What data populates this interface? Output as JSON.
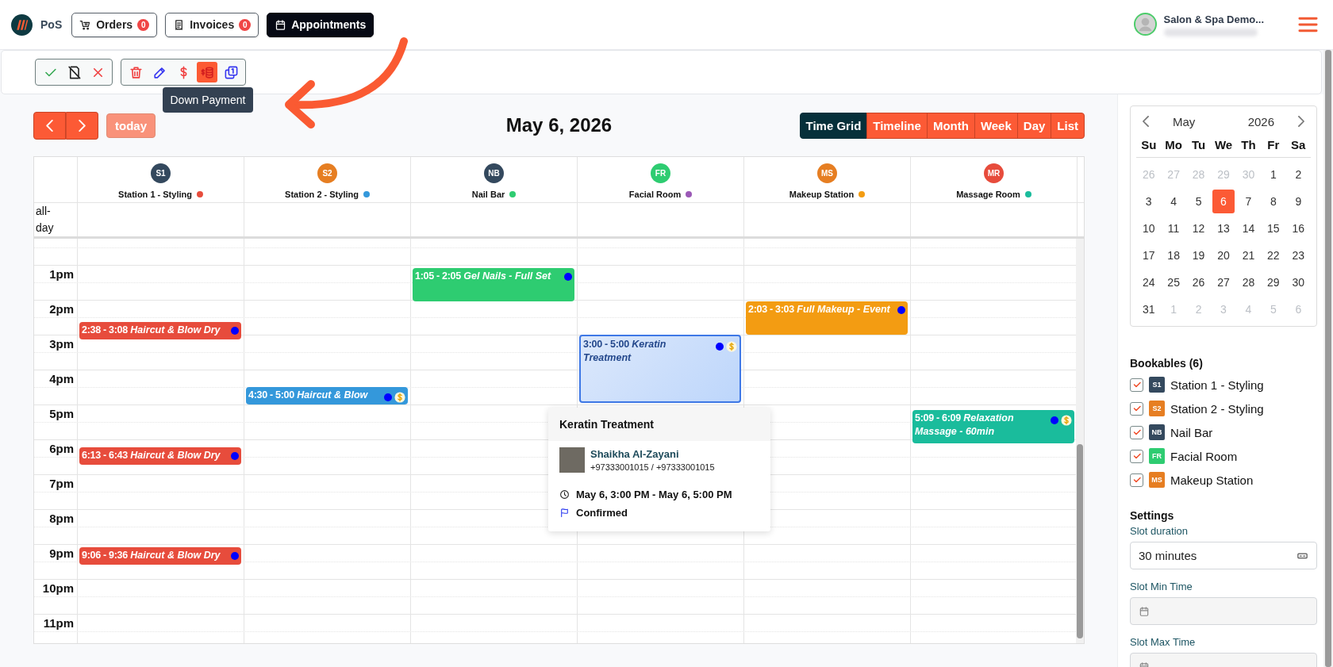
{
  "topbar": {
    "brand": "PoS",
    "tabs": [
      {
        "label": "Orders",
        "kind": "orders",
        "badge": "0",
        "selected": false
      },
      {
        "label": "Invoices",
        "kind": "invoices",
        "badge": "0",
        "selected": false
      },
      {
        "label": "Appointments",
        "kind": "appointments",
        "selected": true
      }
    ],
    "user": {
      "name": "Salon & Spa Demo..."
    }
  },
  "toolbar": {
    "groups": [
      {
        "buttons": [
          {
            "kind": "confirm",
            "selected": false
          },
          {
            "kind": "no_show",
            "selected": false
          },
          {
            "kind": "cancel",
            "selected": false
          }
        ]
      },
      {
        "buttons": [
          {
            "kind": "delete",
            "selected": false
          },
          {
            "kind": "edit",
            "selected": false
          },
          {
            "kind": "payment",
            "selected": false
          },
          {
            "kind": "down_payment",
            "selected": true
          },
          {
            "kind": "duplicate",
            "selected": false
          }
        ]
      }
    ],
    "tooltip": "Down Payment"
  },
  "calendar": {
    "title": "May 6, 2026",
    "today": {
      "label": "today",
      "disabled": true
    },
    "views": [
      {
        "label": "Time Grid",
        "selected": true
      },
      {
        "label": "Timeline",
        "selected": false
      },
      {
        "label": "Month",
        "selected": false
      },
      {
        "label": "Week",
        "selected": false
      },
      {
        "label": "Day",
        "selected": false
      },
      {
        "label": "List",
        "selected": false
      }
    ],
    "all_day_label": "all-day",
    "hours": [
      "1pm",
      "2pm",
      "3pm",
      "4pm",
      "5pm",
      "6pm",
      "7pm",
      "8pm",
      "9pm",
      "10pm",
      "11pm"
    ],
    "resources": [
      {
        "avatar": {
          "initials": "S1",
          "color": "#34495e"
        },
        "name": "Station 1 - Styling",
        "color": "#e74c3c",
        "events": [
          {
            "time": "2:38 - 3:08",
            "title": "Haircut & Blow Dry",
            "paid": false,
            "selected": false
          },
          {
            "time": "6:13 - 6:43",
            "title": "Haircut & Blow Dry",
            "paid": false,
            "selected": false
          },
          {
            "time": "9:06 - 9:36",
            "title": "Haircut & Blow Dry",
            "paid": false,
            "selected": false
          }
        ]
      },
      {
        "avatar": {
          "initials": "S2",
          "color": "#e67e22"
        },
        "name": "Station 2 - Styling",
        "color": "#3498db",
        "events": [
          {
            "time": "4:30 - 5:00",
            "title": "Haircut & Blow",
            "paid": true,
            "selected": false
          }
        ]
      },
      {
        "avatar": {
          "initials": "NB",
          "color": "#34495e"
        },
        "name": "Nail Bar",
        "color": "#2ecc71",
        "events": [
          {
            "time": "1:05 - 2:05",
            "title": "Gel Nails - Full Set",
            "paid": false,
            "selected": false
          }
        ]
      },
      {
        "avatar": {
          "initials": "FR",
          "color": "#2ecc71"
        },
        "name": "Facial Room",
        "color": "#9b59b6",
        "events": [
          {
            "time": "3:00 - 5:00",
            "title": "Keratin Treatment",
            "paid": true,
            "selected": true
          }
        ]
      },
      {
        "avatar": {
          "initials": "MS",
          "color": "#e67e22"
        },
        "name": "Makeup Station",
        "color": "#f39c12",
        "events": [
          {
            "time": "2:03 - 3:03",
            "title": "Full Makeup - Event",
            "paid": false,
            "selected": false
          }
        ]
      },
      {
        "avatar": {
          "initials": "MR",
          "color": "#e74c3c"
        },
        "name": "Massage Room",
        "color": "#1abc9c",
        "events": [
          {
            "time": "5:09 - 6:09",
            "title": "Relaxation Massage - 60min",
            "paid": true,
            "selected": false
          }
        ]
      }
    ],
    "popover": {
      "title": "Keratin Treatment",
      "client": "Shaikha Al-Zayani",
      "phones": "+97333001015 / +97333001015",
      "when": "May 6, 3:00 PM - May 6, 5:00 PM",
      "status": "Confirmed"
    }
  },
  "sidebar": {
    "mini_calendar": {
      "month": "May",
      "year": "2026",
      "weekdays": [
        "Su",
        "Mo",
        "Tu",
        "We",
        "Th",
        "Fr",
        "Sa"
      ],
      "weeks": [
        [
          {
            "day": "26",
            "outside": true,
            "selected": false
          },
          {
            "day": "27",
            "outside": true,
            "selected": false
          },
          {
            "day": "28",
            "outside": true,
            "selected": false
          },
          {
            "day": "29",
            "outside": true,
            "selected": false
          },
          {
            "day": "30",
            "outside": true,
            "selected": false
          },
          {
            "day": "1",
            "outside": false,
            "selected": false
          },
          {
            "day": "2",
            "outside": false,
            "selected": false
          }
        ],
        [
          {
            "day": "3",
            "outside": false,
            "selected": false
          },
          {
            "day": "4",
            "outside": false,
            "selected": false
          },
          {
            "day": "5",
            "outside": false,
            "selected": false
          },
          {
            "day": "6",
            "outside": false,
            "selected": true
          },
          {
            "day": "7",
            "outside": false,
            "selected": false
          },
          {
            "day": "8",
            "outside": false,
            "selected": false
          },
          {
            "day": "9",
            "outside": false,
            "selected": false
          }
        ],
        [
          {
            "day": "10",
            "outside": false,
            "selected": false
          },
          {
            "day": "11",
            "outside": false,
            "selected": false
          },
          {
            "day": "12",
            "outside": false,
            "selected": false
          },
          {
            "day": "13",
            "outside": false,
            "selected": false
          },
          {
            "day": "14",
            "outside": false,
            "selected": false
          },
          {
            "day": "15",
            "outside": false,
            "selected": false
          },
          {
            "day": "16",
            "outside": false,
            "selected": false
          }
        ],
        [
          {
            "day": "17",
            "outside": false,
            "selected": false
          },
          {
            "day": "18",
            "outside": false,
            "selected": false
          },
          {
            "day": "19",
            "outside": false,
            "selected": false
          },
          {
            "day": "20",
            "outside": false,
            "selected": false
          },
          {
            "day": "21",
            "outside": false,
            "selected": false
          },
          {
            "day": "22",
            "outside": false,
            "selected": false
          },
          {
            "day": "23",
            "outside": false,
            "selected": false
          }
        ],
        [
          {
            "day": "24",
            "outside": false,
            "selected": false
          },
          {
            "day": "25",
            "outside": false,
            "selected": false
          },
          {
            "day": "26",
            "outside": false,
            "selected": false
          },
          {
            "day": "27",
            "outside": false,
            "selected": false
          },
          {
            "day": "28",
            "outside": false,
            "selected": false
          },
          {
            "day": "29",
            "outside": false,
            "selected": false
          },
          {
            "day": "30",
            "outside": false,
            "selected": false
          }
        ],
        [
          {
            "day": "31",
            "outside": false,
            "selected": false
          },
          {
            "day": "1",
            "outside": true,
            "selected": false
          },
          {
            "day": "2",
            "outside": true,
            "selected": false
          },
          {
            "day": "3",
            "outside": true,
            "selected": false
          },
          {
            "day": "4",
            "outside": true,
            "selected": false
          },
          {
            "day": "5",
            "outside": true,
            "selected": false
          },
          {
            "day": "6",
            "outside": true,
            "selected": false
          }
        ]
      ]
    },
    "bookables": {
      "title": "Bookables (6)",
      "items": [
        {
          "initials": "S1",
          "name": "Station 1 - Styling",
          "color": "#34495e",
          "checked": true
        },
        {
          "initials": "S2",
          "name": "Station 2 - Styling",
          "color": "#e67e22",
          "checked": true
        },
        {
          "initials": "NB",
          "name": "Nail Bar",
          "color": "#34495e",
          "checked": true
        },
        {
          "initials": "FR",
          "name": "Facial Room",
          "color": "#2ecc71",
          "checked": true
        },
        {
          "initials": "MS",
          "name": "Makeup Station",
          "color": "#e67e22",
          "checked": true
        }
      ]
    },
    "settings": {
      "title": "Settings",
      "fields": [
        {
          "kind": "select",
          "label": "Slot duration",
          "value": "30 minutes"
        },
        {
          "kind": "time",
          "label": "Slot Min Time"
        },
        {
          "kind": "time",
          "label": "Slot Max Time"
        }
      ]
    }
  }
}
